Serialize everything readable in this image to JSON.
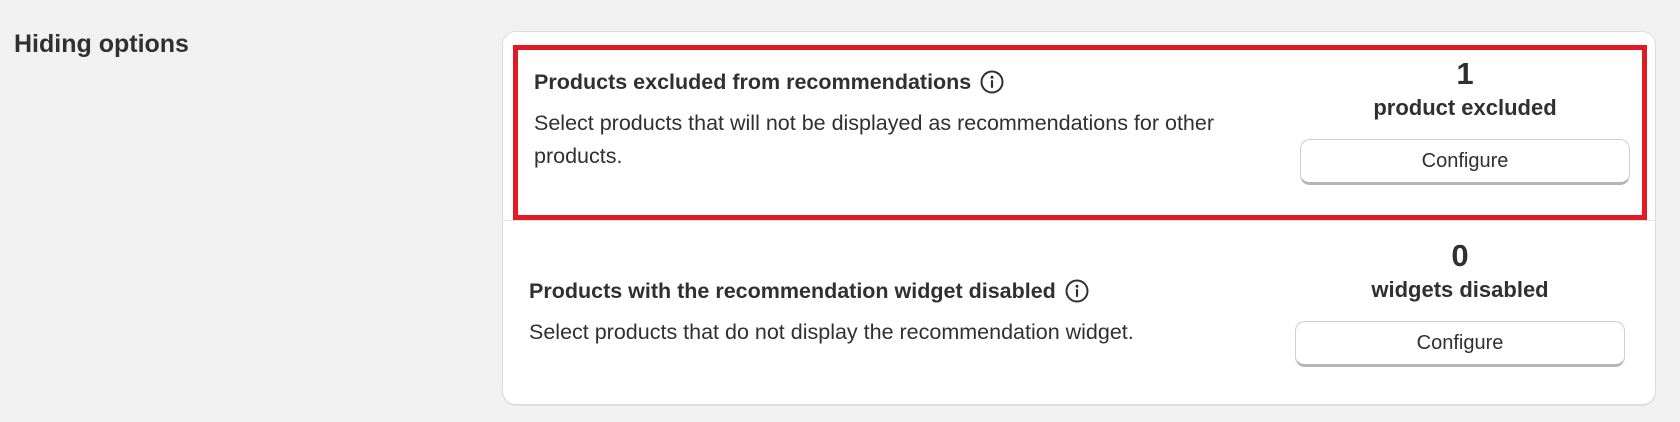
{
  "section": {
    "title": "Hiding options"
  },
  "rows": [
    {
      "heading": "Products excluded from recommendations",
      "description": "Select products that will not be displayed as recommendations for other products.",
      "count": "1",
      "count_label": "product excluded",
      "button_label": "Configure",
      "highlighted": true
    },
    {
      "heading": "Products with the recommendation widget disabled",
      "description": "Select products that do not display the recommendation widget.",
      "count": "0",
      "count_label": "widgets disabled",
      "button_label": "Configure",
      "highlighted": false
    }
  ],
  "icons": {
    "info": "info-icon"
  },
  "colors": {
    "highlight": "#e01b24",
    "text": "#303030",
    "background": "#f1f1f1",
    "card": "#ffffff"
  }
}
